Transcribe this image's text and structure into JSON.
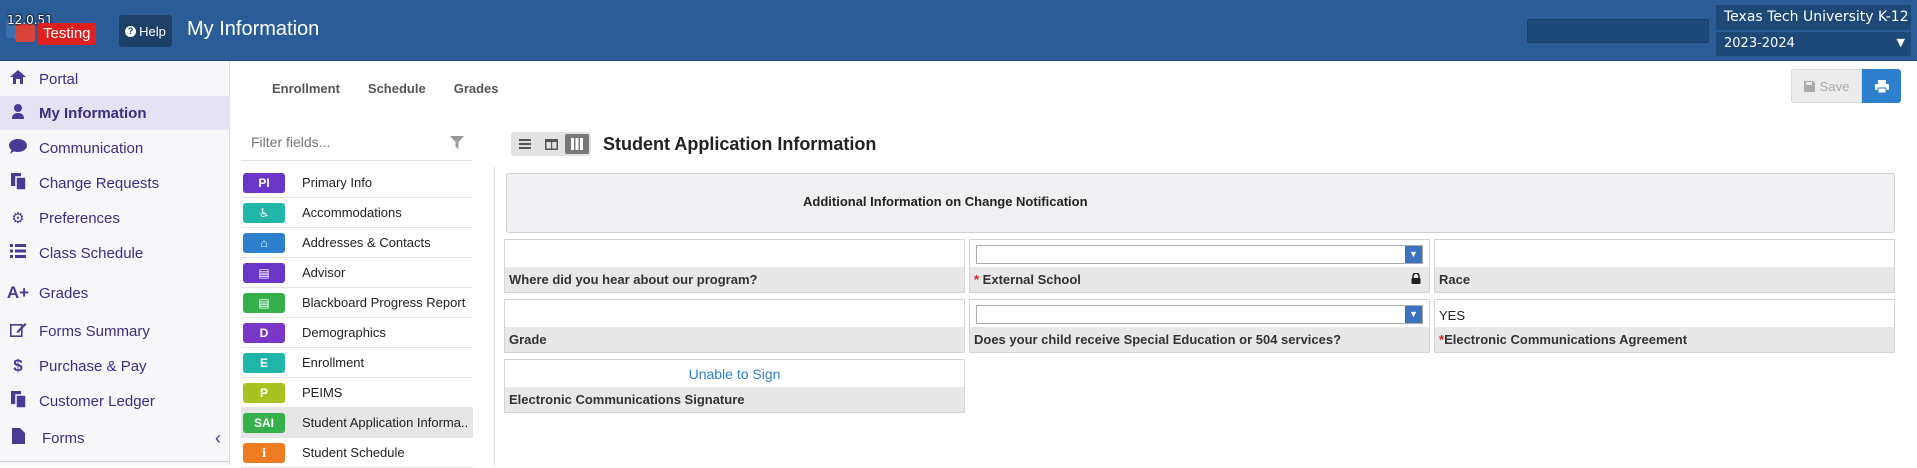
{
  "header": {
    "version": "12.0.51",
    "environment_badge": "Testing",
    "help_label": "Help",
    "page_title": "My Information",
    "organization": "Texas Tech University K-12",
    "school_year": "2023-2024"
  },
  "sidebar": {
    "items": [
      {
        "label": "Portal",
        "icon": "home-icon"
      },
      {
        "label": "My Information",
        "icon": "user-icon",
        "active": true
      },
      {
        "label": "Communication",
        "icon": "comment-icon"
      },
      {
        "label": "Change Requests",
        "icon": "copy-icon"
      },
      {
        "label": "Preferences",
        "icon": "gear-icon"
      },
      {
        "label": "Class Schedule",
        "icon": "list-icon"
      },
      {
        "label": "Grades",
        "icon": "a-plus-icon"
      },
      {
        "label": "Forms Summary",
        "icon": "edit-icon"
      },
      {
        "label": "Purchase & Pay",
        "icon": "dollar-icon"
      },
      {
        "label": "Customer Ledger",
        "icon": "copy-icon"
      },
      {
        "label": "Forms",
        "icon": "file-icon"
      }
    ]
  },
  "tabs": [
    "Enrollment",
    "Schedule",
    "Grades"
  ],
  "toolbar": {
    "save_label": "Save"
  },
  "filter": {
    "placeholder": "Filter fields..."
  },
  "fields": [
    {
      "abbr": "PI",
      "name": "Primary Info",
      "color": "#6a35c9"
    },
    {
      "abbr": "♿",
      "name": "Accommodations",
      "color": "#1fb5a8"
    },
    {
      "abbr": "⌂",
      "name": "Addresses & Contacts",
      "color": "#2f7fcf"
    },
    {
      "abbr": "▤",
      "name": "Advisor",
      "color": "#6a35c9"
    },
    {
      "abbr": "▤",
      "name": "Blackboard Progress Report",
      "color": "#35b04a"
    },
    {
      "abbr": "D",
      "name": "Demographics",
      "color": "#7a35c9"
    },
    {
      "abbr": "E",
      "name": "Enrollment",
      "color": "#1fb5a8"
    },
    {
      "abbr": "P",
      "name": "PEIMS",
      "color": "#a8c31f"
    },
    {
      "abbr": "SAI",
      "name": "Student Application Informa...",
      "color": "#35b04a",
      "active": true
    },
    {
      "abbr": "ℹ",
      "name": "Student Schedule",
      "color": "#ef7b22"
    }
  ],
  "section": {
    "title": "Student Application Information",
    "banner": "Additional Information on Change Notification"
  },
  "form": {
    "hear_about": {
      "label": "Where did you hear about our program?",
      "value": ""
    },
    "external_school": {
      "label": "External School",
      "value": ""
    },
    "race": {
      "label": "Race",
      "value": ""
    },
    "grade": {
      "label": "Grade",
      "value": ""
    },
    "special_ed": {
      "label": "Does your child receive Special Education or 504 services?",
      "value": ""
    },
    "comm_agreement": {
      "label": "Electronic Communications Agreement",
      "value": "YES"
    },
    "signature": {
      "label": "Electronic Communications Signature",
      "link": "Unable to Sign"
    }
  }
}
